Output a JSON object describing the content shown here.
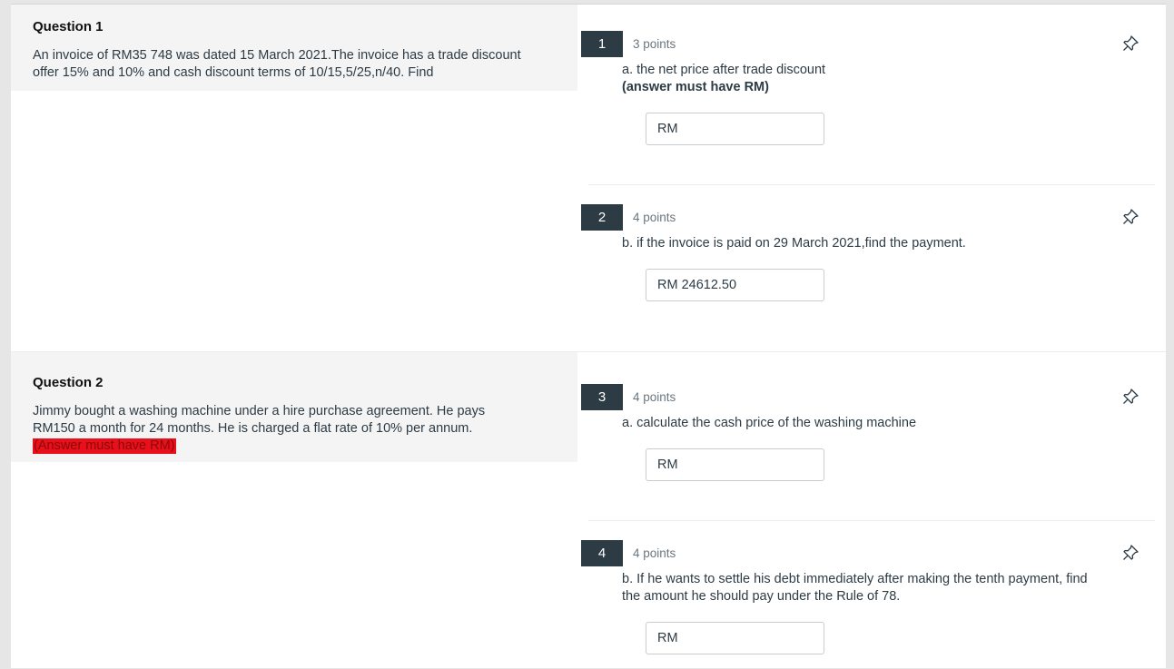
{
  "groups": [
    {
      "title": "Question 1",
      "text_lines": [
        "An invoice of RM35 748 was dated 15 March 2021.The invoice has a trade discount",
        "offer 15% and 10% and cash discount terms of 10/15,5/25,n/40. Find"
      ],
      "highlight": ""
    },
    {
      "title": "Question 2",
      "text_lines": [
        "Jimmy bought a washing machine under a hire purchase agreement. He pays",
        "RM150 a month for 24 months. He is charged a flat rate of 10% per annum."
      ],
      "highlight": "(Answer must have RM)"
    }
  ],
  "questions": [
    {
      "number": "1",
      "points": "3 points",
      "text_lines": [
        "a. the net price after trade discount"
      ],
      "bold_line": "(answer must have RM)",
      "answer": "RM",
      "icon": "pin-icon"
    },
    {
      "number": "2",
      "points": "4 points",
      "text_lines": [
        "b. if the invoice is paid on 29 March 2021,find the payment."
      ],
      "bold_line": "",
      "answer": "RM 24612.50",
      "icon": "pin-icon"
    },
    {
      "number": "3",
      "points": "4 points",
      "text_lines": [
        "a. calculate the cash price of the washing machine"
      ],
      "bold_line": "",
      "answer": "RM",
      "icon": "pin-icon"
    },
    {
      "number": "4",
      "points": "4 points",
      "text_lines": [
        "b. If he wants to settle his debt immediately after making the tenth payment, find",
        "the amount he should pay under the Rule of 78."
      ],
      "bold_line": "",
      "answer": "RM",
      "icon": "pin-icon"
    }
  ],
  "colors": {
    "question_number_bg": "#2d3b45",
    "stimulus_bg": "#f4f4f4",
    "highlight": "#e8101a"
  }
}
